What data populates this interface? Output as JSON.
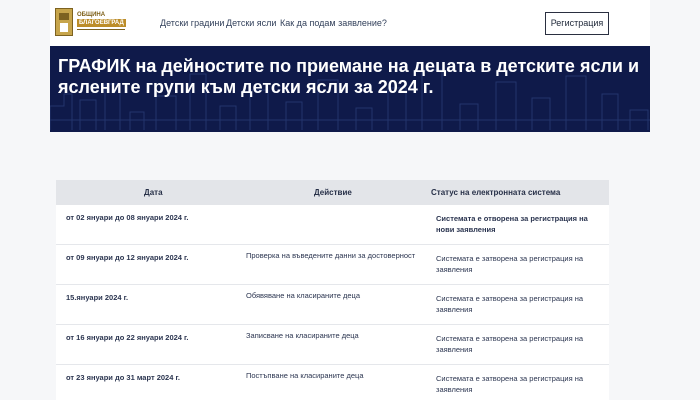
{
  "header": {
    "logo": {
      "line1": "ОБЩИНА",
      "line2": "БЛАГОЕВГРАД"
    },
    "nav": [
      "Детски градини",
      "Детски ясли",
      "Как да подам заявление?"
    ],
    "register_label": "Регистрация"
  },
  "hero": {
    "title": "ГРАФИК на дейностите по приемане на децата в детските ясли и яслените групи към детски ясли за 2024 г."
  },
  "table": {
    "headers": [
      "Дата",
      "Действие",
      "Статус на електронната система"
    ],
    "rows": [
      {
        "date": "от 02 януари до 08 януари 2024 г.",
        "action": "",
        "status": "Системата е отворена за регистрация на нови заявления"
      },
      {
        "date": "от 09 януари до 12 януари 2024 г.",
        "action": "Проверка на въведените данни за достоверност",
        "status": "Системата е затворена за регистрация на заявления"
      },
      {
        "date": "15.януари 2024 г.",
        "action": "Обявяване на класираните деца",
        "status": "Системата е затворена за регистрация на заявления"
      },
      {
        "date": "от 16 януари до 22 януари 2024 г.",
        "action": "Записване на класираните деца",
        "status": "Системата е затворена за регистрация на заявления"
      },
      {
        "date": "от 23 януари до 31 март 2024 г.",
        "action": "Постъпване на класираните деца",
        "status": "Системата е затворена за регистрация на заявления"
      }
    ]
  },
  "colors": {
    "hero_background": "#0f1a4a",
    "page_background": "#f6f7f9",
    "table_header": "#e3e5e9"
  }
}
